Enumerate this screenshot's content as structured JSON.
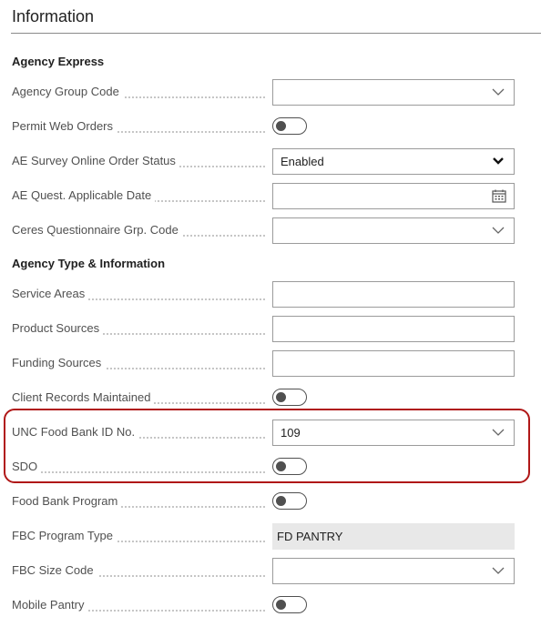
{
  "header": {
    "title": "Information"
  },
  "groups": {
    "agency_express": "Agency Express",
    "agency_type": "Agency Type & Information"
  },
  "fields": {
    "agency_group_code": {
      "label": "Agency Group Code",
      "value": ""
    },
    "permit_web_orders": {
      "label": "Permit Web Orders",
      "checked": false
    },
    "ae_survey_status": {
      "label": "AE Survey Online Order Status",
      "value": "Enabled"
    },
    "ae_quest_date": {
      "label": "AE Quest. Applicable Date",
      "value": "",
      "icon": "calendar-icon"
    },
    "ceres_questionnaire": {
      "label": "Ceres Questionnaire Grp. Code",
      "value": ""
    },
    "service_areas": {
      "label": "Service Areas",
      "value": ""
    },
    "product_sources": {
      "label": "Product Sources",
      "value": ""
    },
    "funding_sources": {
      "label": "Funding Sources",
      "value": ""
    },
    "client_records": {
      "label": "Client Records Maintained",
      "checked": false
    },
    "unc_food_bank_id": {
      "label": "UNC Food Bank ID No.",
      "value": "109"
    },
    "sdo": {
      "label": "SDO",
      "checked": false
    },
    "food_bank_program": {
      "label": "Food Bank Program",
      "checked": false
    },
    "fbc_program_type": {
      "label": "FBC Program Type",
      "value": "FD PANTRY"
    },
    "fbc_size_code": {
      "label": "FBC Size Code",
      "value": ""
    },
    "mobile_pantry": {
      "label": "Mobile Pantry",
      "checked": false
    }
  },
  "colors": {
    "highlight": "#b01717",
    "toggle": "#505050",
    "readonly_bg": "#e8e8e8"
  }
}
